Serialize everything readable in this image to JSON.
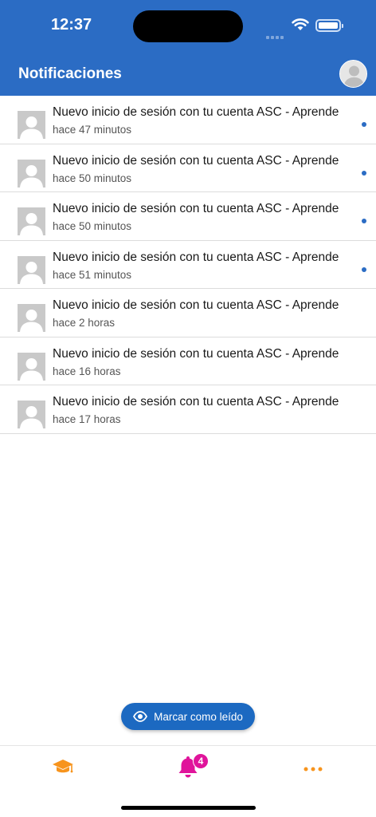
{
  "status_bar": {
    "time": "12:37",
    "icons": [
      "signal-icon",
      "wifi-icon",
      "battery-icon"
    ]
  },
  "header": {
    "title": "Notificaciones",
    "avatar_icon": "user-avatar-icon",
    "background_color": "#2b6cc4"
  },
  "notifications": [
    {
      "title": "Nuevo inicio de sesión con tu cuenta ASC - Aprende",
      "time": "hace 47 minutos",
      "unread": true
    },
    {
      "title": "Nuevo inicio de sesión con tu cuenta ASC - Aprende",
      "time": "hace 50 minutos",
      "unread": true
    },
    {
      "title": "Nuevo inicio de sesión con tu cuenta ASC - Aprende",
      "time": "hace 50 minutos",
      "unread": true
    },
    {
      "title": "Nuevo inicio de sesión con tu cuenta ASC - Aprende",
      "time": "hace 51 minutos",
      "unread": true
    },
    {
      "title": "Nuevo inicio de sesión con tu cuenta ASC - Aprende",
      "time": "hace 2 horas",
      "unread": false
    },
    {
      "title": "Nuevo inicio de sesión con tu cuenta ASC - Aprende",
      "time": "hace 16 horas",
      "unread": false
    },
    {
      "title": "Nuevo inicio de sesión con tu cuenta ASC - Aprende",
      "time": "hace 17 horas",
      "unread": false
    }
  ],
  "actions": {
    "mark_read_label": "Marcar como leído",
    "mark_read_icon": "eye-icon",
    "button_color": "#1c69c1"
  },
  "tab_bar": {
    "tabs": [
      {
        "name": "courses",
        "icon": "graduation-cap-icon",
        "color": "#f7941d"
      },
      {
        "name": "notifications",
        "icon": "bell-icon",
        "color": "#e0149b",
        "badge": "4",
        "selected": true
      },
      {
        "name": "more",
        "icon": "more-dots-icon",
        "color": "#f7941d"
      }
    ]
  }
}
